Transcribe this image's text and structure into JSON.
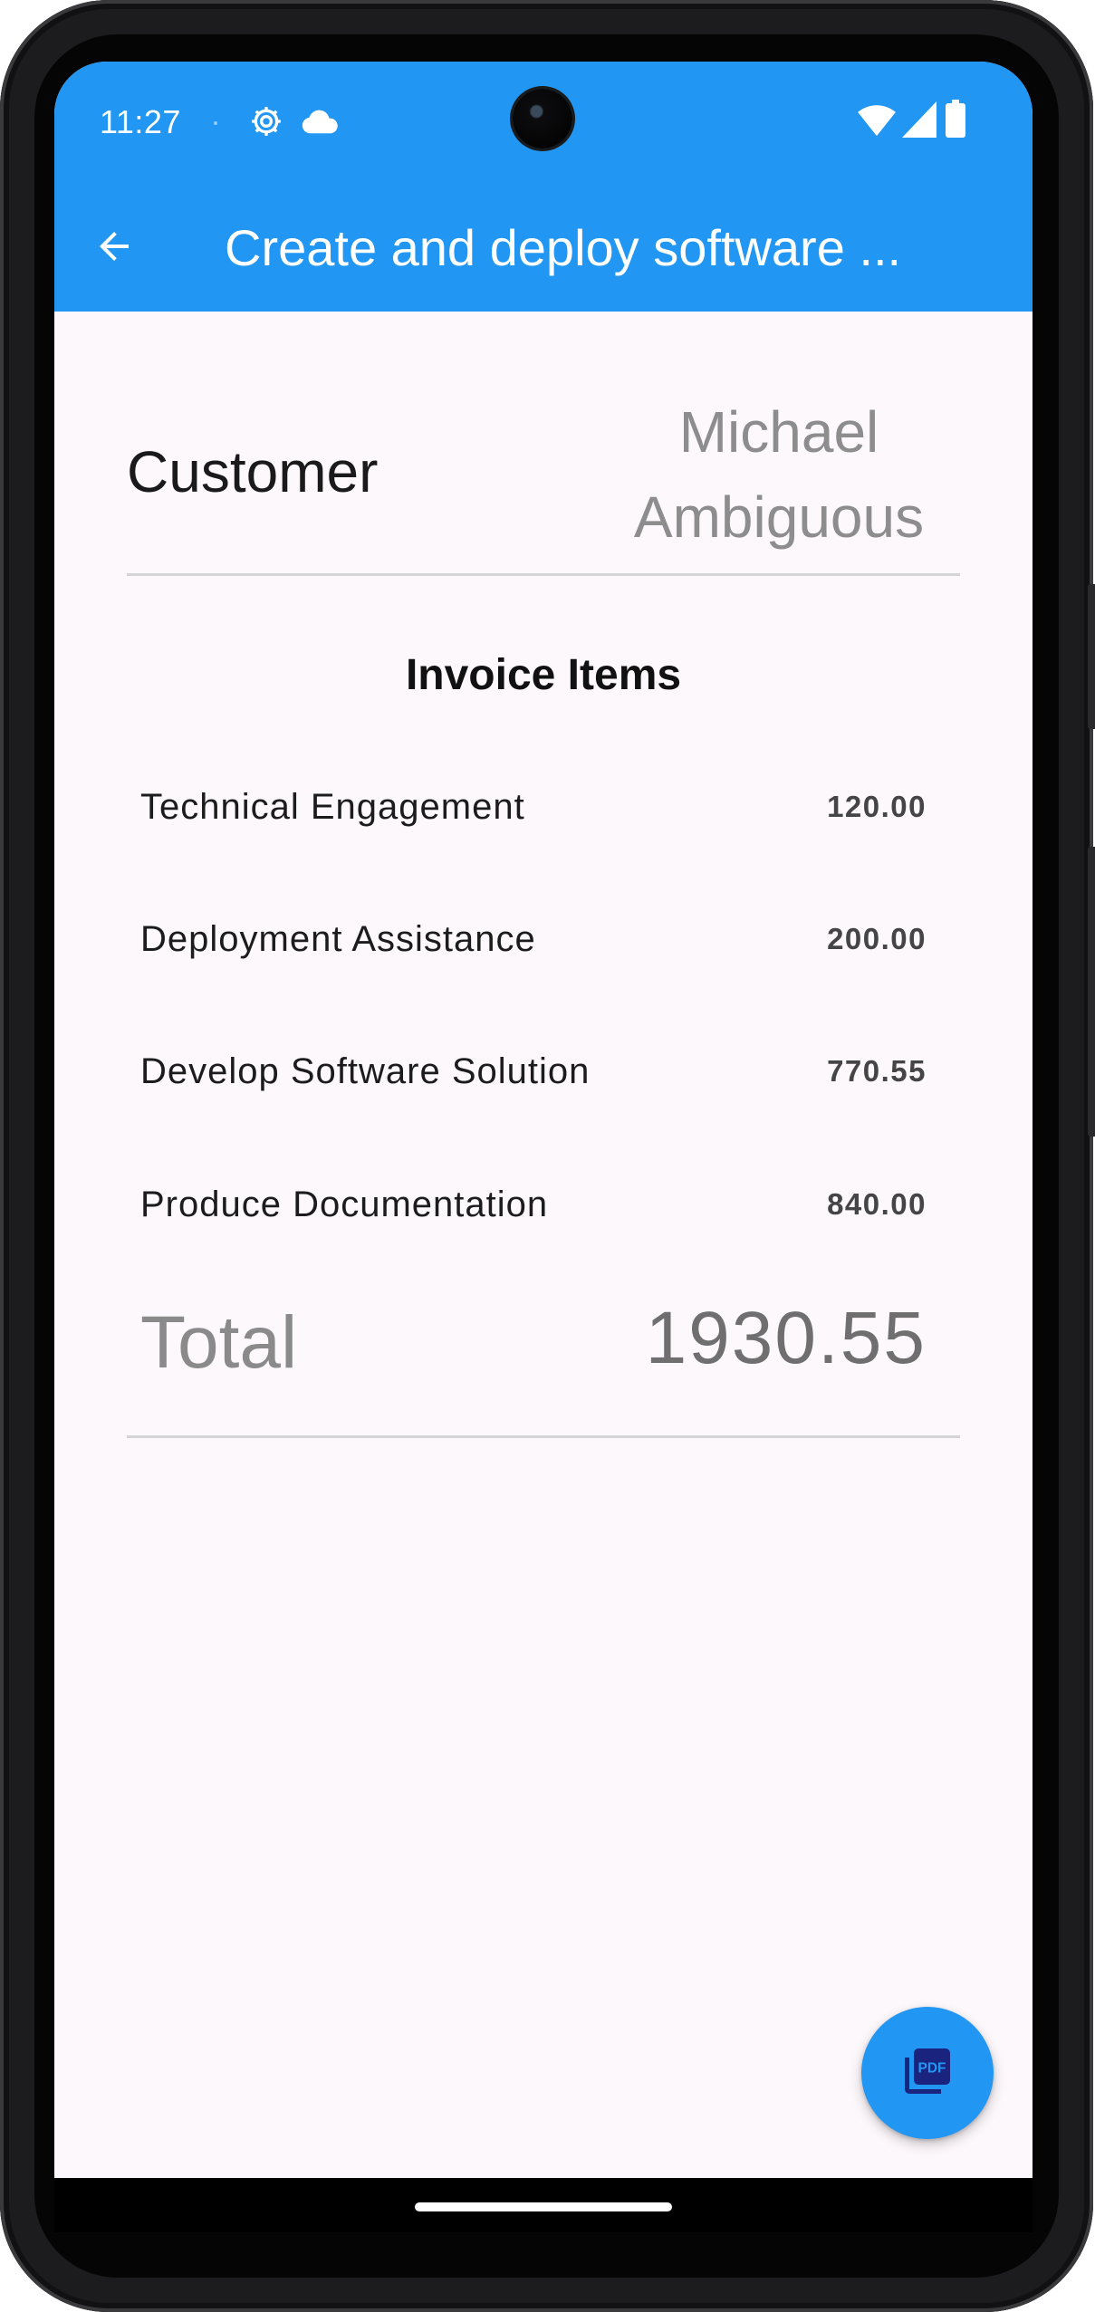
{
  "status_bar": {
    "time": "11:27",
    "icons": [
      "settings-gear-icon",
      "cloud-icon",
      "wifi-icon",
      "cell-signal-icon",
      "battery-icon"
    ]
  },
  "app_bar": {
    "title": "Create and deploy software ...",
    "back_icon": "arrow-back-icon",
    "color": "#2196f3"
  },
  "customer": {
    "label": "Customer",
    "name_line1": "Michael",
    "name_line2": "Ambiguous"
  },
  "invoice": {
    "section_title": "Invoice Items",
    "items": [
      {
        "name": "Technical Engagement",
        "amount": "120.00"
      },
      {
        "name": "Deployment Assistance",
        "amount": "200.00"
      },
      {
        "name": "Develop Software Solution",
        "amount": "770.55"
      },
      {
        "name": "Produce Documentation",
        "amount": "840.00"
      }
    ],
    "total_label": "Total",
    "total_value": "1930.55"
  },
  "fab": {
    "icon": "picture-as-pdf-icon",
    "icon_text": "PDF",
    "color": "#2196f3"
  }
}
